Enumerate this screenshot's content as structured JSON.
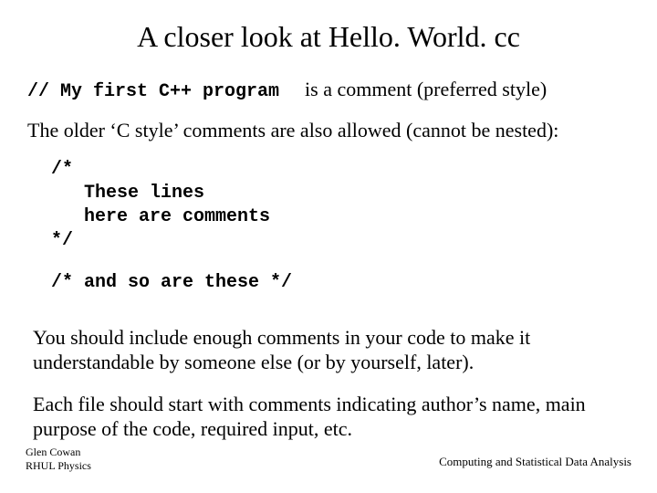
{
  "title": "A closer look at Hello. World. cc",
  "line1": {
    "code": "// My first C++ program",
    "text": "is a comment (preferred style)"
  },
  "cstyle_intro": "The older ‘C style’ comments are also allowed (cannot be nested):",
  "codeblock1": "/*\n   These lines\n   here are comments\n*/",
  "codeblock2": "/* and so are these */",
  "para1": "You should include enough comments in your code to make it understandable by someone else (or by yourself, later).",
  "para2": "Each file should start with comments indicating author’s name, main purpose of the code, required input, etc.",
  "footer": {
    "author": "Glen Cowan",
    "affiliation": "RHUL Physics",
    "course": "Computing and Statistical Data Analysis"
  }
}
